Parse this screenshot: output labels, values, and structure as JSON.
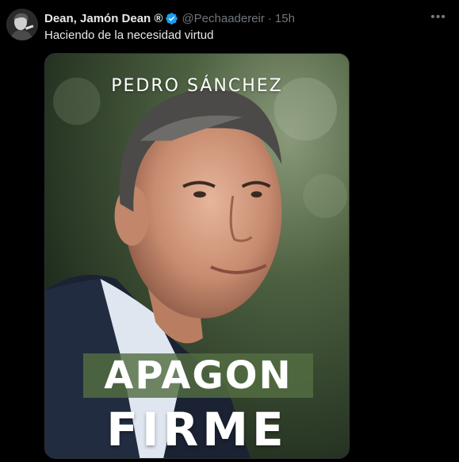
{
  "tweet": {
    "display_name": "Dean, Jamón Dean ®",
    "handle": "@Pechaadereir",
    "separator": "·",
    "time": "15h",
    "more_label": "•••",
    "text": "Haciendo de la necesidad virtud",
    "verified_icon": "verified-badge-icon",
    "colors": {
      "accent": "#1d9bf0",
      "muted": "#71767b",
      "text": "#e7e9ea",
      "background": "#000000"
    }
  },
  "media": {
    "cover_author": "PEDRO SÁNCHEZ",
    "title_line1": "APAGON",
    "title_line2": "FIRME",
    "title_band_color": "#546e42"
  }
}
